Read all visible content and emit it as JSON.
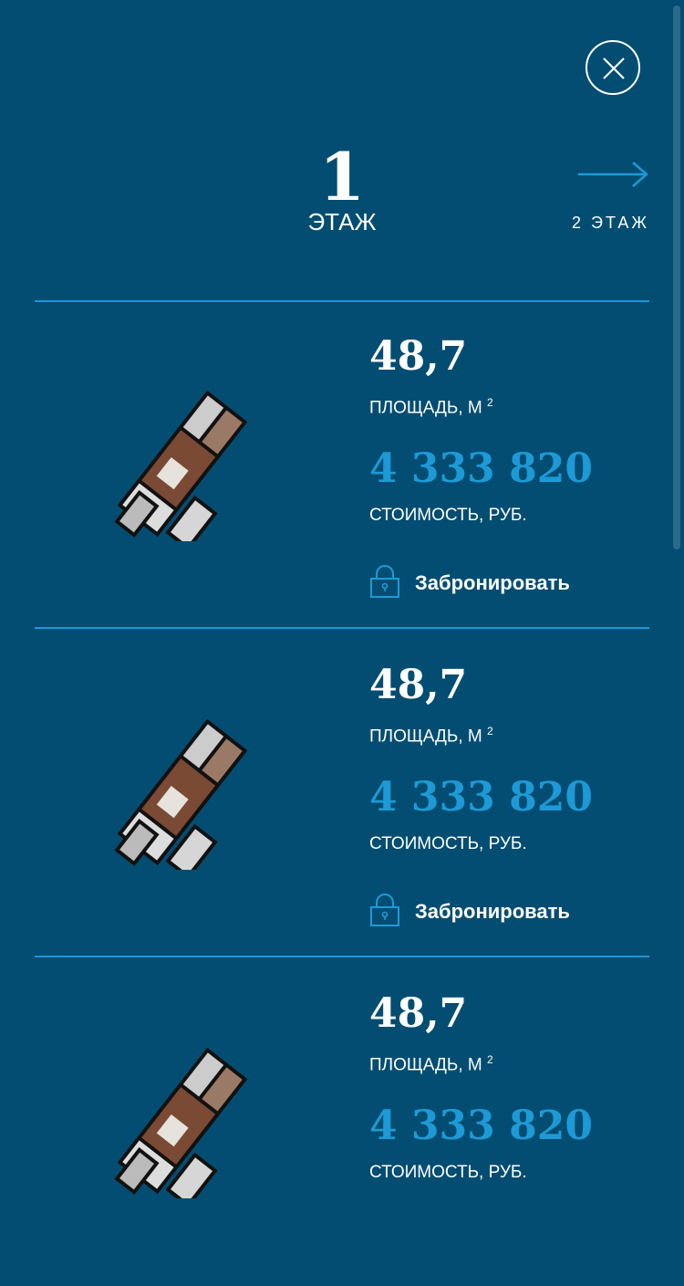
{
  "header": {
    "floor_number": "1",
    "floor_label": "ЭТАЖ",
    "next_floor_label": "2 ЭТАЖ"
  },
  "apartments": [
    {
      "area": "48,7",
      "area_label": "ПЛОЩАДЬ, М",
      "area_unit_sup": "2",
      "price": "4 333 820",
      "price_label": "СТОИМОСТЬ, РУБ.",
      "book_label": "Забронировать"
    },
    {
      "area": "48,7",
      "area_label": "ПЛОЩАДЬ, М",
      "area_unit_sup": "2",
      "price": "4 333 820",
      "price_label": "СТОИМОСТЬ, РУБ.",
      "book_label": "Забронировать"
    },
    {
      "area": "48,7",
      "area_label": "ПЛОЩАДЬ, М",
      "area_unit_sup": "2",
      "price": "4 333 820",
      "price_label": "СТОИМОСТЬ, РУБ.",
      "book_label": ""
    }
  ],
  "colors": {
    "background": "#034d72",
    "accent": "#1d9ad6",
    "divider": "#1b97d9"
  },
  "icons": {
    "close": "close-icon",
    "next": "arrow-right-icon",
    "lock": "lock-icon",
    "plan": "floor-plan-image"
  }
}
